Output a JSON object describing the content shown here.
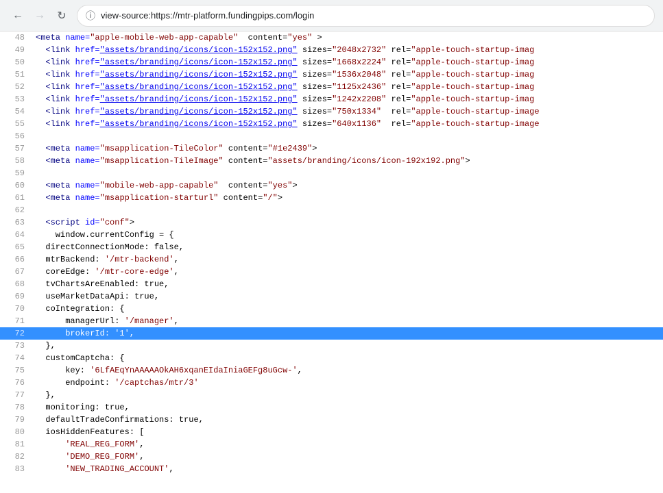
{
  "browser": {
    "url": "view-source:https://mtr-platform.fundingpips.com/login",
    "back_disabled": false,
    "forward_disabled": true
  },
  "lines": [
    {
      "num": 48,
      "html": "<span class='tag'>&lt;meta</span> <span class='attr-name'>name=</span><span class='attr-value'>&quot;apple-mobile-web-app-capable&quot;</span>  content=<span class='attr-value'>&quot;yes&quot;</span> &gt;"
    },
    {
      "num": 49,
      "html": "  <span class='tag'>&lt;link</span> <span class='attr-name'>href=</span><span class='link'>&quot;assets/branding/icons/icon-152x152.png&quot;</span> sizes=<span class='attr-value'>&quot;2048x2732&quot;</span> rel=<span class='attr-value'>&quot;apple-touch-startup-imag</span>"
    },
    {
      "num": 50,
      "html": "  <span class='tag'>&lt;link</span> <span class='attr-name'>href=</span><span class='link'>&quot;assets/branding/icons/icon-152x152.png&quot;</span> sizes=<span class='attr-value'>&quot;1668x2224&quot;</span> rel=<span class='attr-value'>&quot;apple-touch-startup-imag</span>"
    },
    {
      "num": 51,
      "html": "  <span class='tag'>&lt;link</span> <span class='attr-name'>href=</span><span class='link'>&quot;assets/branding/icons/icon-152x152.png&quot;</span> sizes=<span class='attr-value'>&quot;1536x2048&quot;</span> rel=<span class='attr-value'>&quot;apple-touch-startup-imag</span>"
    },
    {
      "num": 52,
      "html": "  <span class='tag'>&lt;link</span> <span class='attr-name'>href=</span><span class='link'>&quot;assets/branding/icons/icon-152x152.png&quot;</span> sizes=<span class='attr-value'>&quot;1125x2436&quot;</span> rel=<span class='attr-value'>&quot;apple-touch-startup-imag</span>"
    },
    {
      "num": 53,
      "html": "  <span class='tag'>&lt;link</span> <span class='attr-name'>href=</span><span class='link'>&quot;assets/branding/icons/icon-152x152.png&quot;</span> sizes=<span class='attr-value'>&quot;1242x2208&quot;</span> rel=<span class='attr-value'>&quot;apple-touch-startup-imag</span>"
    },
    {
      "num": 54,
      "html": "  <span class='tag'>&lt;link</span> <span class='attr-name'>href=</span><span class='link'>&quot;assets/branding/icons/icon-152x152.png&quot;</span> sizes=<span class='attr-value'>&quot;750x1334&quot;</span>  rel=<span class='attr-value'>&quot;apple-touch-startup-image</span>"
    },
    {
      "num": 55,
      "html": "  <span class='tag'>&lt;link</span> <span class='attr-name'>href=</span><span class='link'>&quot;assets/branding/icons/icon-152x152.png&quot;</span> sizes=<span class='attr-value'>&quot;640x1136&quot;</span>  rel=<span class='attr-value'>&quot;apple-touch-startup-image</span>"
    },
    {
      "num": 56,
      "html": ""
    },
    {
      "num": 57,
      "html": "  <span class='tag'>&lt;meta</span> <span class='attr-name'>name=</span><span class='attr-value'>&quot;msapplication-TileColor&quot;</span> content=<span class='attr-value'>&quot;#1e2439&quot;</span>&gt;"
    },
    {
      "num": 58,
      "html": "  <span class='tag'>&lt;meta</span> <span class='attr-name'>name=</span><span class='attr-value'>&quot;msapplication-TileImage&quot;</span> content=<span class='attr-value'>&quot;assets/branding/icons/icon-192x192.png&quot;</span>&gt;"
    },
    {
      "num": 59,
      "html": ""
    },
    {
      "num": 60,
      "html": "  <span class='tag'>&lt;meta</span> <span class='attr-name'>name=</span><span class='attr-value'>&quot;mobile-web-app-capable&quot;</span>  content=<span class='attr-value'>&quot;yes&quot;</span>&gt;"
    },
    {
      "num": 61,
      "html": "  <span class='tag'>&lt;meta</span> <span class='attr-name'>name=</span><span class='attr-value'>&quot;msapplication-starturl&quot;</span> content=<span class='attr-value'>&quot;/&quot;</span>&gt;"
    },
    {
      "num": 62,
      "html": ""
    },
    {
      "num": 63,
      "html": "  <span class='tag'>&lt;script</span> <span class='attr-name'>id=</span><span class='attr-value'>&quot;conf&quot;</span>&gt;"
    },
    {
      "num": 64,
      "html": "    window.currentConfig = {"
    },
    {
      "num": 65,
      "html": "  directConnectionMode: false,"
    },
    {
      "num": 66,
      "html": "  mtrBackend: <span class='string-val'>'/mtr-backend'</span>,"
    },
    {
      "num": 67,
      "html": "  coreEdge: <span class='string-val'>'/mtr-core-edge'</span>,"
    },
    {
      "num": 68,
      "html": "  tvChartsAreEnabled: true,"
    },
    {
      "num": 69,
      "html": "  useMarketDataApi: true,"
    },
    {
      "num": 70,
      "html": "  coIntegration: {"
    },
    {
      "num": 71,
      "html": "      managerUrl: <span class='string-val'>'/manager'</span>,"
    },
    {
      "num": 72,
      "html": "      brokerId: <span class='string-val'>'1'</span>,",
      "highlighted": true
    },
    {
      "num": 73,
      "html": "  },"
    },
    {
      "num": 74,
      "html": "  customCaptcha: {"
    },
    {
      "num": 75,
      "html": "      key: <span class='string-val'>'6LfAEqYnAAAAAOkAH6xqanEIdaIniaGEFg8uGcw-'</span>,"
    },
    {
      "num": 76,
      "html": "      endpoint: <span class='string-val'>'/captchas/mtr/3'</span>"
    },
    {
      "num": 77,
      "html": "  },"
    },
    {
      "num": 78,
      "html": "  monitoring: true,"
    },
    {
      "num": 79,
      "html": "  defaultTradeConfirmations: true,"
    },
    {
      "num": 80,
      "html": "  iosHiddenFeatures: ["
    },
    {
      "num": 81,
      "html": "      <span class='string-val'>'REAL_REG_FORM'</span>,"
    },
    {
      "num": 82,
      "html": "      <span class='string-val'>'DEMO_REG_FORM'</span>,"
    },
    {
      "num": 83,
      "html": "      <span class='string-val'>'NEW_TRADING_ACCOUNT'</span>,"
    }
  ]
}
